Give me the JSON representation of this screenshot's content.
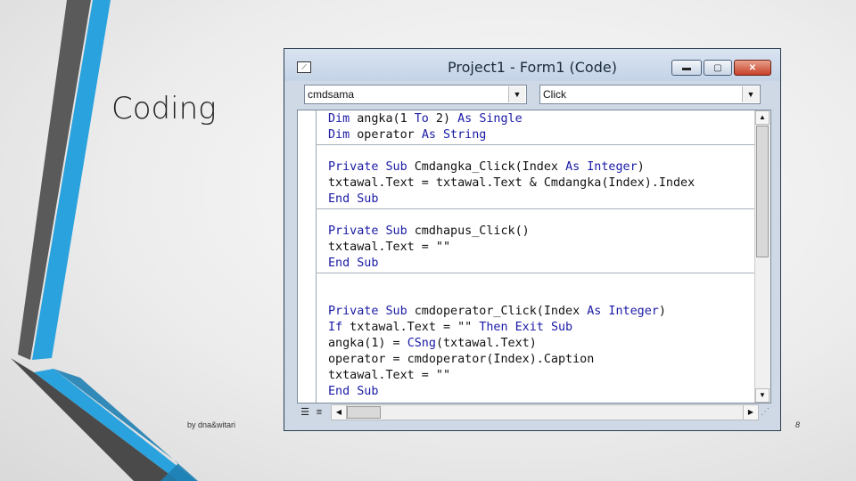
{
  "slide": {
    "title": "Coding",
    "footer": "by dna&witari",
    "page_number": "8"
  },
  "window": {
    "title": "Project1 - Form1 (Code)",
    "object_combo": "cmdsama",
    "procedure_combo": "Click",
    "buttons": {
      "minimize": "▬",
      "maximize": "▢",
      "close": "✕"
    }
  },
  "code": {
    "lines": [
      "Dim angka(1 To 2) As Single",
      "Dim operator As String",
      "Private Sub Cmdangka_Click(Index As Integer)",
      "txtawal.Text = txtawal.Text & Cmdangka(Index).Index",
      "End Sub",
      "Private Sub cmdhapus_Click()",
      "txtawal.Text = \"\"",
      "End Sub",
      "Private Sub cmdoperator_Click(Index As Integer)",
      "If txtawal.Text = \"\" Then Exit Sub",
      "angka(1) = CSng(txtawal.Text)",
      "operator = cmdoperator(Index).Caption",
      "txtawal.Text = \"\"",
      "End Sub"
    ]
  },
  "colors": {
    "keyword": "#1a1aa6",
    "accent_blue": "#29a3df",
    "accent_dark": "#4a4a4a"
  }
}
